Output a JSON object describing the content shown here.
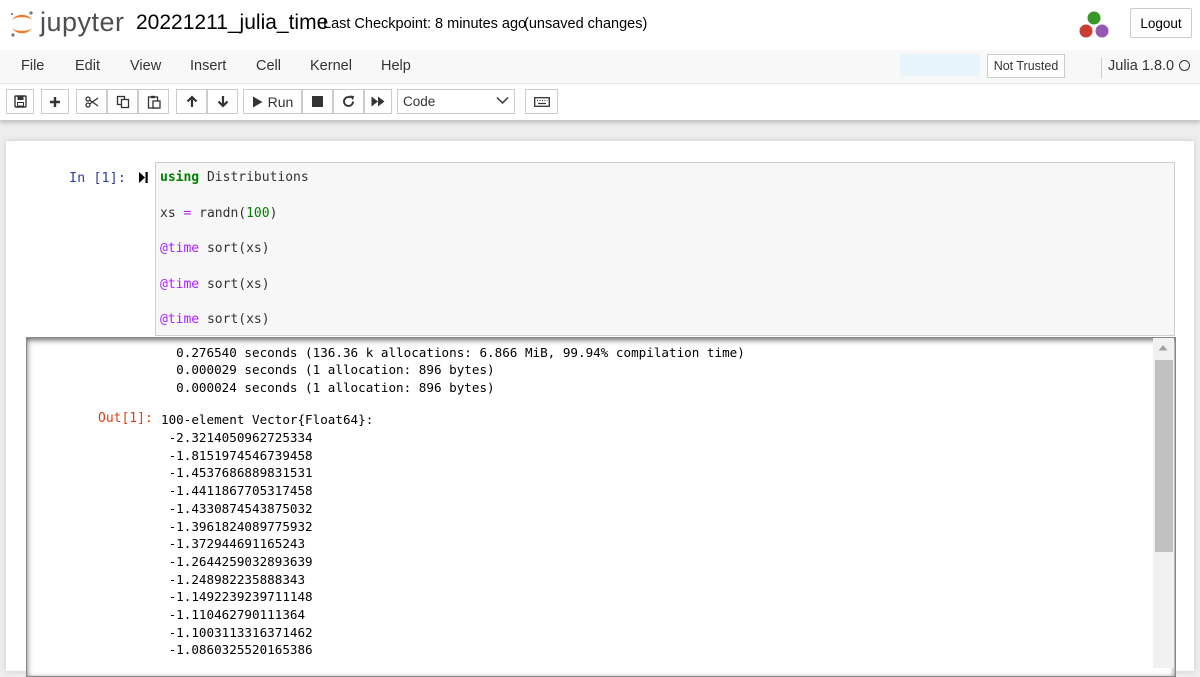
{
  "header": {
    "logo_text": "jupyter",
    "notebook_name": "20221211_julia_time",
    "checkpoint": "Last Checkpoint: 8 minutes ago",
    "autosave_status": "(unsaved changes)",
    "logout_label": "Logout"
  },
  "menubar": {
    "items": [
      "File",
      "Edit",
      "View",
      "Insert",
      "Cell",
      "Kernel",
      "Help"
    ],
    "trust_label": "Not Trusted",
    "kernel_name": "Julia 1.8.0"
  },
  "toolbar": {
    "run_label": "Run",
    "cell_type": "Code",
    "icons": [
      "save-icon",
      "plus-icon",
      "cut-icon",
      "copy-icon",
      "paste-icon",
      "arrow-up-icon",
      "arrow-down-icon",
      "run-icon",
      "stop-icon",
      "restart-icon",
      "fast-forward-icon",
      "keyboard-icon"
    ]
  },
  "cell": {
    "in_prompt": "In [1]:",
    "code": {
      "line1_kw": "using",
      "line1_rest": " Distributions",
      "line2_var": "xs ",
      "line2_op": "=",
      "line2_fn": " randn(",
      "line2_num": "100",
      "line2_end": ")",
      "macro": "@time",
      "sort_call": " sort(xs)"
    },
    "stdout": [
      "  0.276540 seconds (136.36 k allocations: 6.866 MiB, 99.94% compilation time)",
      "  0.000029 seconds (1 allocation: 896 bytes)",
      "  0.000024 seconds (1 allocation: 896 bytes)"
    ],
    "out_prompt": "Out[1]:",
    "result_header": "100-element Vector{Float64}:",
    "result_values": [
      " -2.3214050962725334",
      " -1.8151974546739458",
      " -1.4537686889831531",
      " -1.4411867705317458",
      " -1.4330874543875032",
      " -1.3961824089775932",
      " -1.372944691165243",
      " -1.2644259032893639",
      " -1.248982235888343",
      " -1.1492239239711148",
      " -1.110462790111364",
      " -1.1003113316371462",
      " -1.0860325520165386"
    ]
  },
  "colors": {
    "in_prompt": "#303f9f",
    "out_prompt": "#d84315",
    "keyword": "#008000",
    "macro": "#aa22ff",
    "logo_orange": "#f37726"
  }
}
